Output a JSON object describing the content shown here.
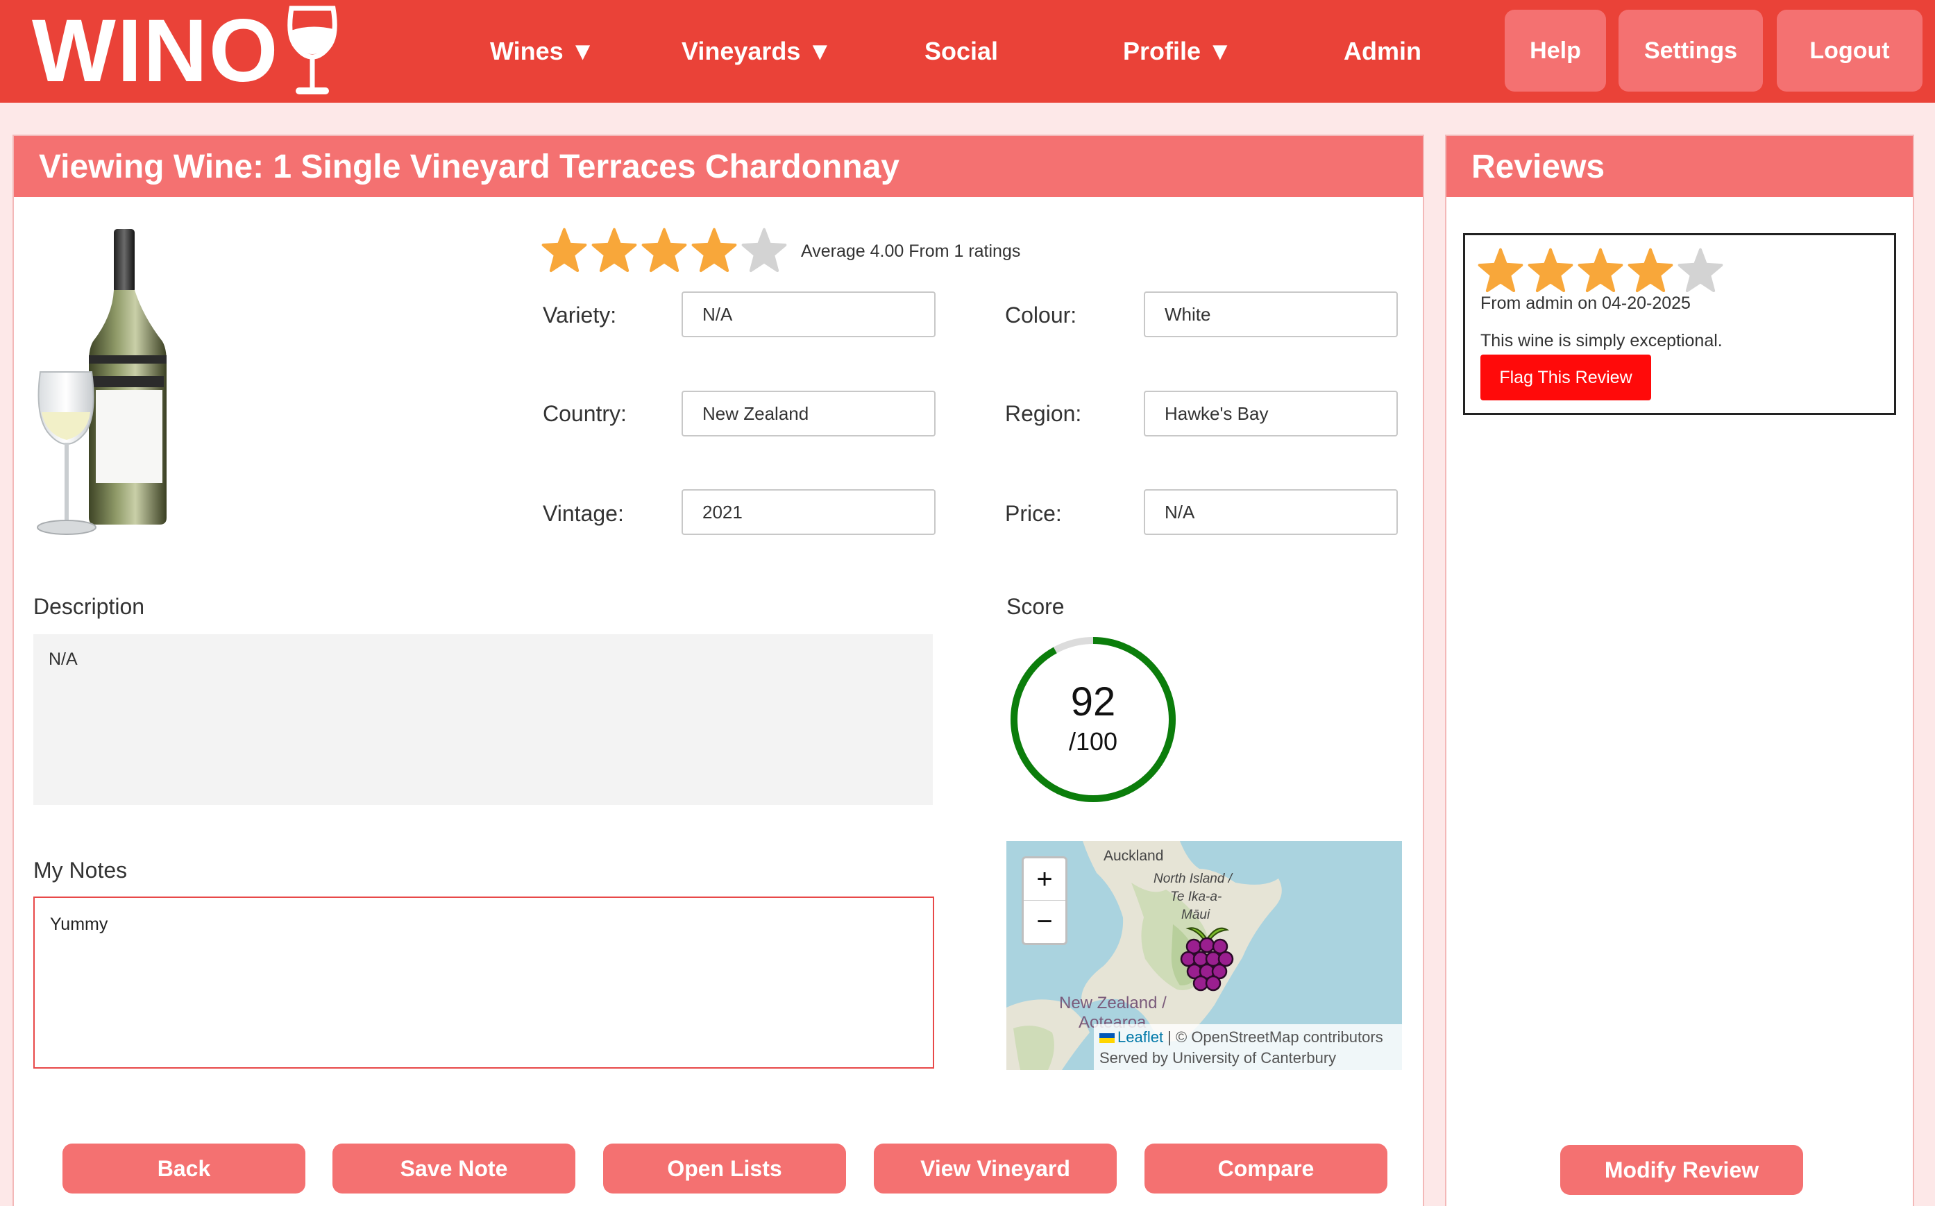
{
  "nav": {
    "logo_text": "WINO",
    "wines": "Wines ▼",
    "vineyards": "Vineyards ▼",
    "social": "Social",
    "profile": "Profile ▼",
    "admin": "Admin",
    "help": "Help",
    "settings": "Settings",
    "logout": "Logout"
  },
  "wine": {
    "title": "Viewing Wine: 1 Single Vineyard Terraces Chardonnay",
    "rating_text": "Average 4.00 From 1 ratings",
    "rating_stars": 4,
    "max_stars": 5,
    "variety_label": "Variety:",
    "variety": "N/A",
    "colour_label": "Colour:",
    "colour": "White",
    "country_label": "Country:",
    "country": "New Zealand",
    "region_label": "Region:",
    "region": "Hawke's Bay",
    "vintage_label": "Vintage:",
    "vintage": "2021",
    "price_label": "Price:",
    "price": "N/A",
    "description_label": "Description",
    "description": "N/A",
    "score_label": "Score",
    "score": "92",
    "score_max": "/100",
    "score_fraction": 0.92,
    "notes_label": "My Notes",
    "notes": "Yummy"
  },
  "map": {
    "zoom_in": "+",
    "zoom_out": "−",
    "label_auckland": "Auckland",
    "label_north_island_1": "North Island /",
    "label_north_island_2": "Te Ika-a-",
    "label_north_island_3": "Māui",
    "label_nz_1": "New Zealand /",
    "label_nz_2": "Aotearoa",
    "attribution_leaflet": "Leaflet",
    "attribution_rest": " | © OpenStreetMap contributors",
    "served_by": "Served by University of Canterbury"
  },
  "actions": {
    "back": "Back",
    "save_note": "Save Note",
    "open_lists": "Open Lists",
    "view_vineyard": "View Vineyard",
    "compare": "Compare"
  },
  "reviews": {
    "title": "Reviews",
    "items": [
      {
        "stars": 4,
        "meta": "From admin on 04-20-2025",
        "text": "This wine is simply exceptional.",
        "flag_label": "Flag This Review"
      }
    ],
    "modify_label": "Modify Review"
  },
  "colors": {
    "brand_red": "#ea4238",
    "header_pink": "#f47171",
    "star_filled": "#f8a73a",
    "star_empty": "#d3d3d3",
    "score_ring": "#0b7d0b",
    "flag_red": "#ff0a0a"
  }
}
